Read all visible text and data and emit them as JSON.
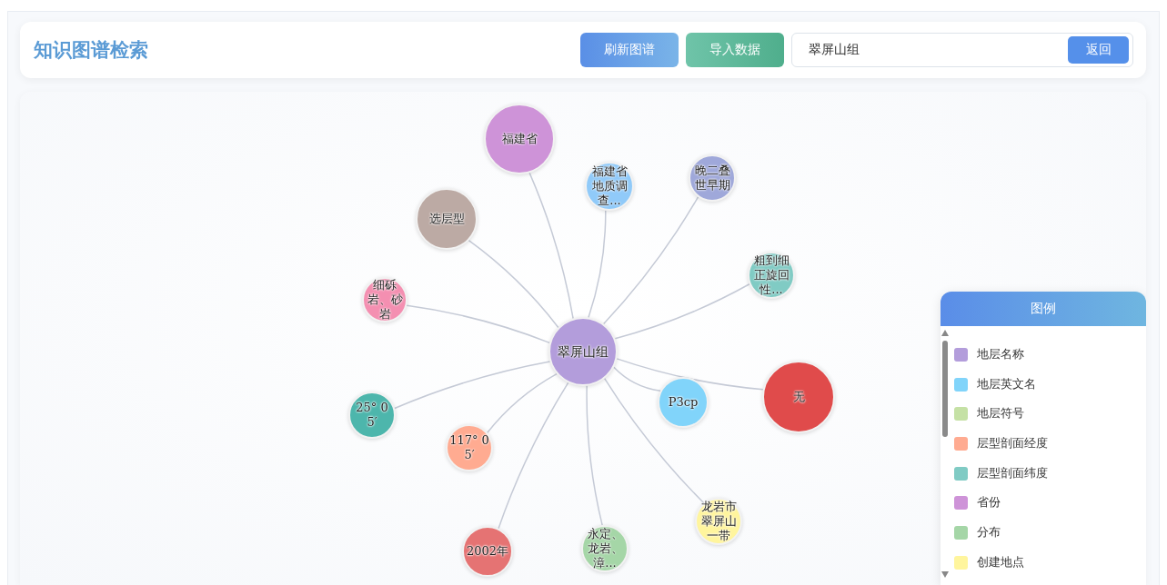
{
  "header": {
    "title": "知识图谱检索",
    "buttons": [
      {
        "label": "刷新图谱",
        "kind": "refresh"
      },
      {
        "label": "导入数据",
        "kind": "import"
      }
    ],
    "search": {
      "value": "翠屏山组",
      "button": "返回"
    }
  },
  "graph": {
    "nodes": [
      {
        "label": "翠屏山组",
        "color": "#b39ddb",
        "kind": "center"
      },
      {
        "label": "福建省",
        "color": "#ce93d8",
        "kind": "leaf"
      },
      {
        "label": "福建省地质调查...",
        "color": "#90caf9",
        "kind": "leaf"
      },
      {
        "label": "晚二叠世早期",
        "color": "#9fa8da",
        "kind": "leaf"
      },
      {
        "label": "选层型",
        "color": "#bcaaa4",
        "kind": "leaf"
      },
      {
        "label": "粗到细正旋回性...",
        "color": "#80cbc4",
        "kind": "leaf"
      },
      {
        "label": "细砾岩、砂岩",
        "color": "#f48fb1",
        "kind": "leaf"
      },
      {
        "label": "无",
        "color": "#e04b4b",
        "kind": "leaf"
      },
      {
        "label": "P3cp",
        "color": "#81d4fa",
        "kind": "leaf"
      },
      {
        "label": "25° 05′",
        "color": "#4db6ac",
        "kind": "leaf"
      },
      {
        "label": "117° 05′",
        "color": "#ffab91",
        "kind": "leaf"
      },
      {
        "label": "龙岩市翠屏山一带",
        "color": "#fff59d",
        "kind": "leaf"
      },
      {
        "label": "2002年",
        "color": "#e57373",
        "kind": "leaf"
      },
      {
        "label": "永定、龙岩、漳...",
        "color": "#a5d6a7",
        "kind": "leaf"
      }
    ]
  },
  "legend": {
    "title": "图例",
    "items": [
      {
        "label": "地层名称",
        "color": "#b39ddb"
      },
      {
        "label": "地层英文名",
        "color": "#81d4fa"
      },
      {
        "label": "地层符号",
        "color": "#c5e1a5"
      },
      {
        "label": "层型剖面经度",
        "color": "#ffab91"
      },
      {
        "label": "层型剖面纬度",
        "color": "#80cbc4"
      },
      {
        "label": "省份",
        "color": "#ce93d8"
      },
      {
        "label": "分布",
        "color": "#a5d6a7"
      },
      {
        "label": "创建地点",
        "color": "#fff59d"
      }
    ]
  }
}
